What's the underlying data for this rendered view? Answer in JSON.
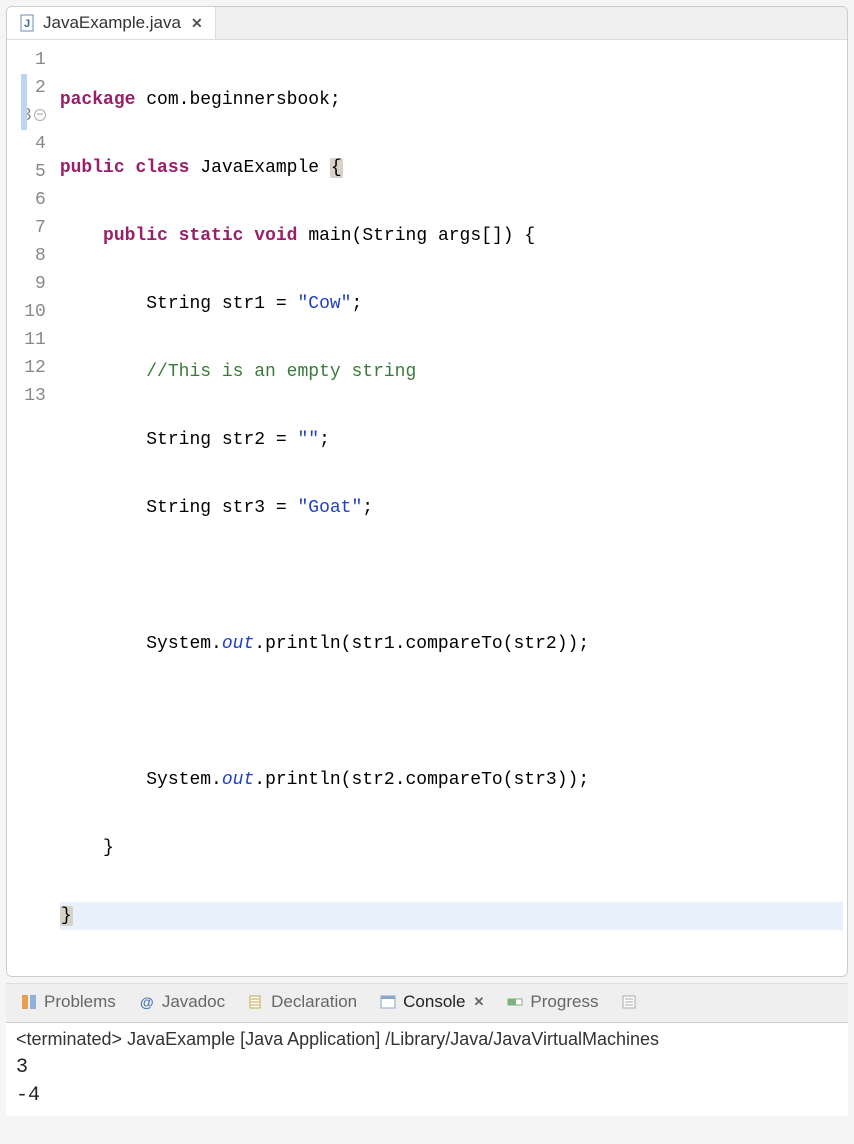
{
  "tab": {
    "filename": "JavaExample.java"
  },
  "code": {
    "lines": {
      "l1": {
        "num": "1"
      },
      "l2": {
        "num": "2"
      },
      "l3": {
        "num": "3"
      },
      "l4": {
        "num": "4"
      },
      "l5": {
        "num": "5"
      },
      "l6": {
        "num": "6"
      },
      "l7": {
        "num": "7"
      },
      "l8": {
        "num": "8"
      },
      "l9": {
        "num": "9"
      },
      "l10": {
        "num": "10"
      },
      "l11": {
        "num": "11"
      },
      "l12": {
        "num": "12"
      },
      "l13": {
        "num": "13"
      }
    },
    "tokens": {
      "package": "package",
      "public": "public",
      "class": "class",
      "static": "static",
      "void": "void",
      "className": "JavaExample",
      "main": "main",
      "StringType": "String",
      "args": "args",
      "pkg": " com.beginnersbook;",
      "lbrace": "{",
      "rbrace": "}",
      "str1decl": " str1 = ",
      "str2decl": " str2 = ",
      "str3decl": " str3 = ",
      "cow": "\"Cow\"",
      "empty": "\"\"",
      "goat": "\"Goat\"",
      "semi": ";",
      "comment": "//This is an empty string",
      "system": "System.",
      "out": "out",
      "println1": ".println(str1.compareTo(str2));",
      "println2": ".println(str2.compareTo(str3));",
      "mainSig1": "(String args[]) {"
    }
  },
  "views": {
    "problems": "Problems",
    "javadoc": "Javadoc",
    "declaration": "Declaration",
    "console": "Console",
    "progress": "Progress"
  },
  "console": {
    "status": "<terminated> JavaExample [Java Application] /Library/Java/JavaVirtualMachines",
    "out1": "3",
    "out2": "-4"
  }
}
